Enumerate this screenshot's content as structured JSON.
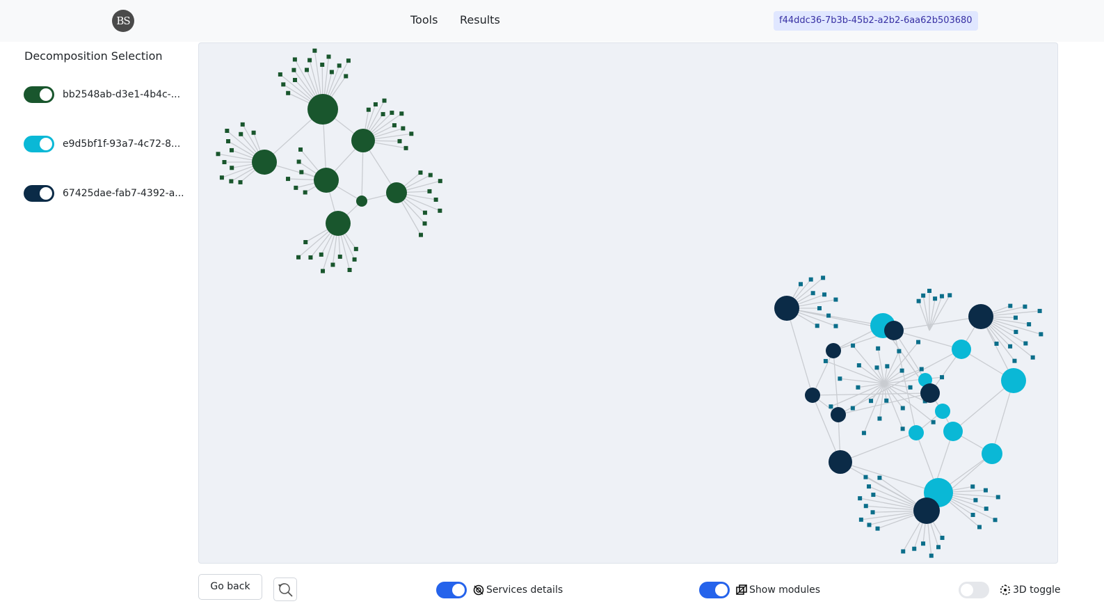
{
  "header": {
    "logo_text": "BS",
    "nav": [
      "Tools",
      "Results"
    ],
    "session_id": "f44ddc36-7b3b-45b2-a2b2-6aa62b503680"
  },
  "sidebar": {
    "title": "Decomposition Selection",
    "decompositions": [
      {
        "label": "bb2548ab-d3e1-4b4c-...",
        "enabled": true,
        "color": "#19562d"
      },
      {
        "label": "e9d5bf1f-93a7-4c72-8...",
        "enabled": true,
        "color": "#0ab8d6"
      },
      {
        "label": "67425dae-fab7-4392-a...",
        "enabled": true,
        "color": "#0b2b47"
      }
    ]
  },
  "graph": {
    "edge_color": "#c9ccd1",
    "module_color_dark": "#0b6e8a",
    "clusters": [
      "decomposition-1",
      "decomposition-2-3-overlay"
    ]
  },
  "footer": {
    "go_back_label": "Go back",
    "reset_icon": "zoom-reset-icon",
    "services_details": {
      "label": "Services details",
      "enabled": true,
      "icon": "services-icon"
    },
    "show_modules": {
      "label": "Show modules",
      "enabled": true,
      "icon": "modules-icon"
    },
    "toggle_3d": {
      "label": "3D toggle",
      "enabled": false,
      "icon": "3d-icon"
    }
  },
  "colors": {
    "accent_blue": "#2563eb",
    "canvas_bg": "#eef1f6"
  }
}
